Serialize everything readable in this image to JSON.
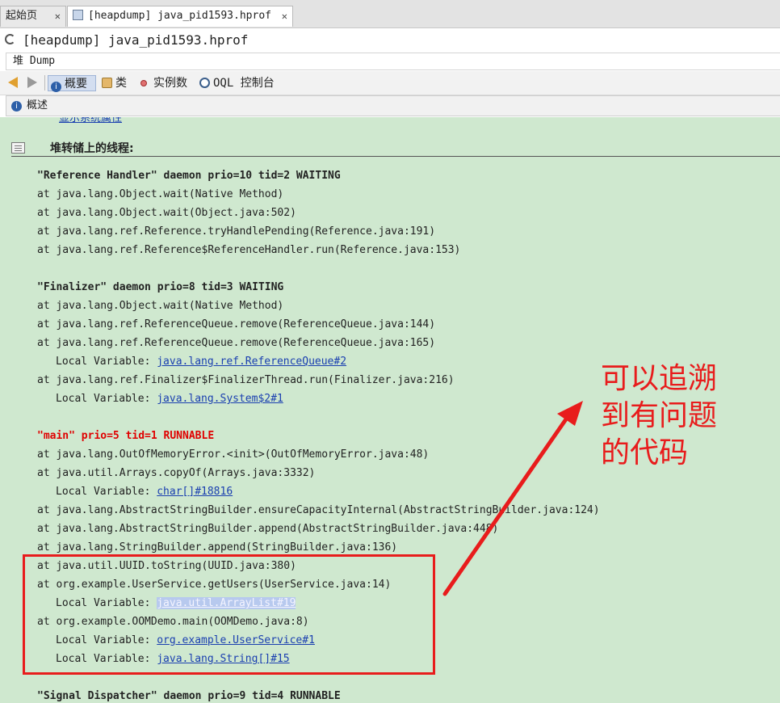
{
  "tabs": [
    {
      "label": "起始页",
      "close": "✕"
    },
    {
      "label": "[heapdump] java_pid1593.hprof",
      "close": "✕"
    }
  ],
  "window_title": "[heapdump] java_pid1593.hprof",
  "dump_label": "堆 Dump",
  "toolbar": {
    "summary": "概要",
    "classes": "类",
    "instances": "实例数",
    "oql": "OQL 控制台"
  },
  "overview_label": "概述",
  "content": {
    "system_props_link": "显示系统属性",
    "section_title": "堆转储上的线程:",
    "threads": [
      {
        "header": "\"Reference Handler\" daemon prio=10 tid=2 WAITING",
        "lines": [
          {
            "t": "at java.lang.Object.wait(Native Method)"
          },
          {
            "t": "at java.lang.Object.wait(Object.java:502)"
          },
          {
            "t": "at java.lang.ref.Reference.tryHandlePending(Reference.java:191)"
          },
          {
            "t": "at java.lang.ref.Reference$ReferenceHandler.run(Reference.java:153)"
          }
        ]
      },
      {
        "header": "\"Finalizer\" daemon prio=8 tid=3 WAITING",
        "lines": [
          {
            "t": "at java.lang.Object.wait(Native Method)"
          },
          {
            "t": "at java.lang.ref.ReferenceQueue.remove(ReferenceQueue.java:144)"
          },
          {
            "t": "at java.lang.ref.ReferenceQueue.remove(ReferenceQueue.java:165)"
          },
          {
            "t": "Local Variable: ",
            "link": "java.lang.ref.ReferenceQueue#2"
          },
          {
            "t": "at java.lang.ref.Finalizer$FinalizerThread.run(Finalizer.java:216)"
          },
          {
            "t": "Local Variable: ",
            "link": "java.lang.System$2#1"
          }
        ]
      },
      {
        "header": "\"main\" prio=5 tid=1 RUNNABLE",
        "lines": [
          {
            "t": "at java.lang.OutOfMemoryError.<init>(OutOfMemoryError.java:48)"
          },
          {
            "t": "at java.util.Arrays.copyOf(Arrays.java:3332)"
          },
          {
            "t": "Local Variable: ",
            "link": "char[]#18816"
          },
          {
            "t": "at java.lang.AbstractStringBuilder.ensureCapacityInternal(AbstractStringBuilder.java:124)"
          },
          {
            "t": "at java.lang.AbstractStringBuilder.append(AbstractStringBuilder.java:448)"
          },
          {
            "t": "at java.lang.StringBuilder.append(StringBuilder.java:136)"
          },
          {
            "t": "at java.util.UUID.toString(UUID.java:380)"
          },
          {
            "t": "at org.example.UserService.getUsers(UserService.java:14)"
          },
          {
            "t": "Local Variable: ",
            "link": "java.util.ArrayList#19",
            "selected": true
          },
          {
            "t": "at org.example.OOMDemo.main(OOMDemo.java:8)"
          },
          {
            "t": "Local Variable: ",
            "link": "org.example.UserService#1"
          },
          {
            "t": "Local Variable: ",
            "link": "java.lang.String[]#15"
          }
        ]
      },
      {
        "header": "\"Signal Dispatcher\" daemon prio=9 tid=4 RUNNABLE",
        "lines": []
      }
    ]
  },
  "annotation": [
    "可以追溯",
    "到有问题",
    "的代码"
  ],
  "colors": {
    "content_bg": "#cfe8cf",
    "highlight_red": "#e81c1c",
    "link": "#1a3fb0"
  }
}
